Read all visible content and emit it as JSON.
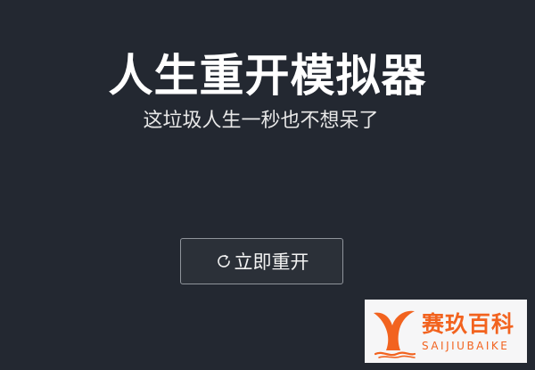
{
  "header": {
    "title": "人生重开模拟器",
    "subtitle": "这垃圾人生一秒也不想呆了"
  },
  "main": {
    "restart_label": "立即重开",
    "restart_icon": "refresh-icon"
  },
  "watermark": {
    "name_cn": "赛玖百科",
    "name_en": "SAIJIUBAIKE",
    "logo_icon": "whale-tail-icon",
    "brand_color": "#f2631f"
  },
  "colors": {
    "background": "#232831",
    "text": "#ffffff",
    "button_border": "#8f949b"
  }
}
